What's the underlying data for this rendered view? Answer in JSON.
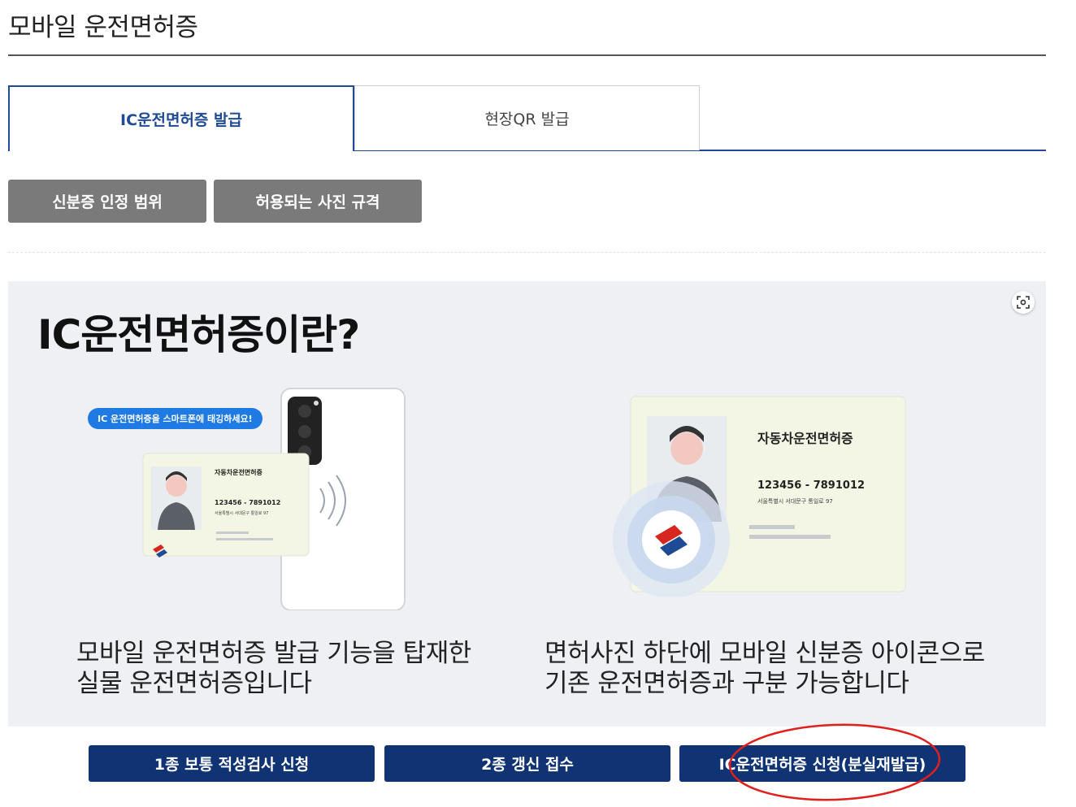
{
  "page": {
    "title": "모바일 운전면허증"
  },
  "tabs": [
    {
      "label": "IC운전면허증 발급",
      "active": true
    },
    {
      "label": "현장QR 발급",
      "active": false
    }
  ],
  "info_buttons": [
    "신분증 인정 범위",
    "허용되는 사진 규격"
  ],
  "panel": {
    "heading": "IC운전면허증이란?",
    "zoom_icon": "zoom-icon",
    "left": {
      "bubble": "IC 운전면허증을 스마트폰에 태깅하세요!",
      "card_title": "자동차운전면허증",
      "card_number": "123456 - 7891012",
      "card_address": "서울특별시 서대문구 통일로 97",
      "caption_line1": "모바일 운전면허증 발급 기능을 탑재한",
      "caption_line2": "실물 운전면허증입니다"
    },
    "right": {
      "card_title": "자동차운전면허증",
      "card_number": "123456 - 7891012",
      "card_address": "서울특별시 서대문구 통일로 97",
      "caption_line1": "면허사진 하단에 모바일 신분증 아이콘으로",
      "caption_line2": "기존 운전면허증과 구분 가능합니다"
    }
  },
  "action_buttons": [
    "1종 보통 적성검사 신청",
    "2종 갱신 접수",
    "IC운전면허증 신청(분실재발급)"
  ],
  "colors": {
    "navy": "#103373",
    "tab_blue": "#1f4a94",
    "gray_button": "#7a7a7a",
    "panel_bg": "#eef0f3",
    "annotation_red": "#e0201c",
    "bubble_blue": "#1f7be3"
  }
}
